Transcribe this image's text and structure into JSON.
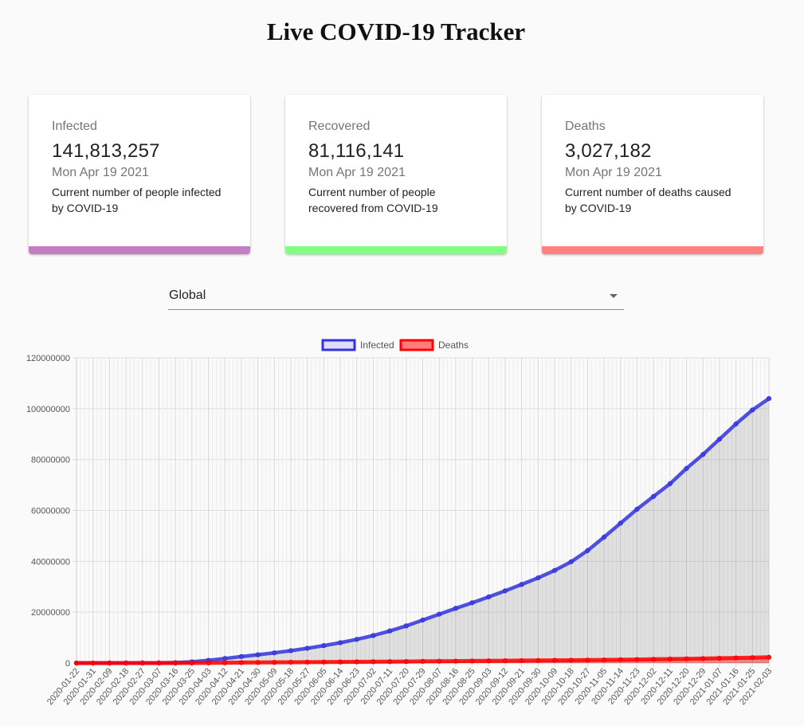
{
  "header": {
    "title": "Live COVID-19 Tracker"
  },
  "cards": [
    {
      "label": "Infected",
      "value": "141,813,257",
      "date": "Mon Apr 19 2021",
      "description": "Current number of people infected by COVID-19",
      "color": "#c47fc0"
    },
    {
      "label": "Recovered",
      "value": "81,116,141",
      "date": "Mon Apr 19 2021",
      "description": "Current number of people recovered from COVID-19",
      "color": "#80ff80"
    },
    {
      "label": "Deaths",
      "value": "3,027,182",
      "date": "Mon Apr 19 2021",
      "description": "Current number of deaths caused by COVID-19",
      "color": "#ff8080"
    }
  ],
  "country_select": {
    "value": "Global",
    "icon": "arrow-drop-down-icon"
  },
  "chart_data": {
    "type": "line",
    "legend_position": "top",
    "grid": true,
    "ylim": [
      0,
      120000000
    ],
    "yticks": [
      "0",
      "20000000",
      "40000000",
      "60000000",
      "80000000",
      "100000000",
      "120000000"
    ],
    "categories": [
      "2020-01-22",
      "2020-01-31",
      "2020-02-09",
      "2020-02-18",
      "2020-02-27",
      "2020-03-07",
      "2020-03-16",
      "2020-03-25",
      "2020-04-03",
      "2020-04-12",
      "2020-04-21",
      "2020-04-30",
      "2020-05-09",
      "2020-05-18",
      "2020-05-27",
      "2020-06-05",
      "2020-06-14",
      "2020-06-23",
      "2020-07-02",
      "2020-07-11",
      "2020-07-20",
      "2020-07-29",
      "2020-08-07",
      "2020-08-16",
      "2020-08-25",
      "2020-09-03",
      "2020-09-12",
      "2020-09-21",
      "2020-09-30",
      "2020-10-09",
      "2020-10-18",
      "2020-10-27",
      "2020-11-05",
      "2020-11-14",
      "2020-11-23",
      "2020-12-02",
      "2020-12-11",
      "2020-12-20",
      "2020-12-29",
      "2021-01-07",
      "2021-01-16",
      "2021-01-25",
      "2021-02-03"
    ],
    "series": [
      {
        "name": "Infected",
        "color": "#3333dd",
        "fill": "rgba(0,0,0,0.1)",
        "values": [
          600,
          9900,
          40000,
          73000,
          83000,
          105000,
          180000,
          470000,
          1050000,
          1800000,
          2550000,
          3250000,
          4000000,
          4850000,
          5800000,
          6850000,
          8000000,
          9300000,
          10800000,
          12600000,
          14600000,
          16900000,
          19200000,
          21500000,
          23700000,
          26000000,
          28400000,
          30900000,
          33500000,
          36400000,
          39800000,
          44200000,
          49500000,
          55000000,
          60500000,
          65500000,
          70500000,
          76500000,
          82000000,
          88000000,
          94000000,
          99500000,
          104000000
        ]
      },
      {
        "name": "Deaths",
        "color": "#ff0000",
        "fill": "rgba(255,0,0,0.4)",
        "values": [
          17,
          213,
          900,
          2000,
          2800,
          3600,
          7000,
          22000,
          60000,
          115000,
          175000,
          230000,
          275000,
          315000,
          355000,
          395000,
          430000,
          470000,
          515000,
          560000,
          605000,
          660000,
          715000,
          765000,
          810000,
          865000,
          910000,
          960000,
          1010000,
          1060000,
          1110000,
          1160000,
          1230000,
          1300000,
          1380000,
          1470000,
          1560000,
          1660000,
          1760000,
          1880000,
          2010000,
          2140000,
          2260000
        ]
      }
    ]
  }
}
